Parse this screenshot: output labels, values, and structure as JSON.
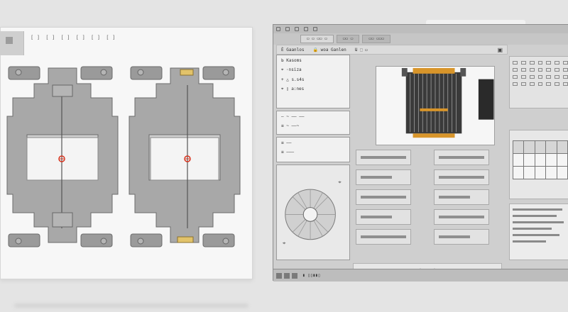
{
  "doc": {
    "toolbar": [
      "[ ]",
      "[ ]",
      "[ ]",
      "[ ]",
      "[ ]",
      "[ ]"
    ],
    "marker_left": "✻",
    "marker_right": "✻"
  },
  "app": {
    "tabs": [
      "▭ ▭ ▭▭ ▭",
      "▭▭ ▭",
      "▭▭ ▭▭▭"
    ],
    "subbar": [
      "Ѐ Gaanlos",
      "🔒 woa Ganlen",
      "Ա ⬚ ▭"
    ],
    "subbar_close": "▣",
    "cards": [
      [
        "Ь Kasoms",
        "⌖ ·nsiza",
        "+ △ s.s4s",
        "⌖ ▯ a:nes"
      ],
      [
        "— ~ —— ——",
        "≡ ~ ——~"
      ],
      [
        "≡ ——",
        "≡ ———"
      ]
    ],
    "foot_marks": [
      "⌖",
      "⌖"
    ],
    "status": "▮ ▯▯▮▮▯"
  },
  "colors": {
    "accent_orange": "#d8952a",
    "marker_red": "#d9341e"
  }
}
